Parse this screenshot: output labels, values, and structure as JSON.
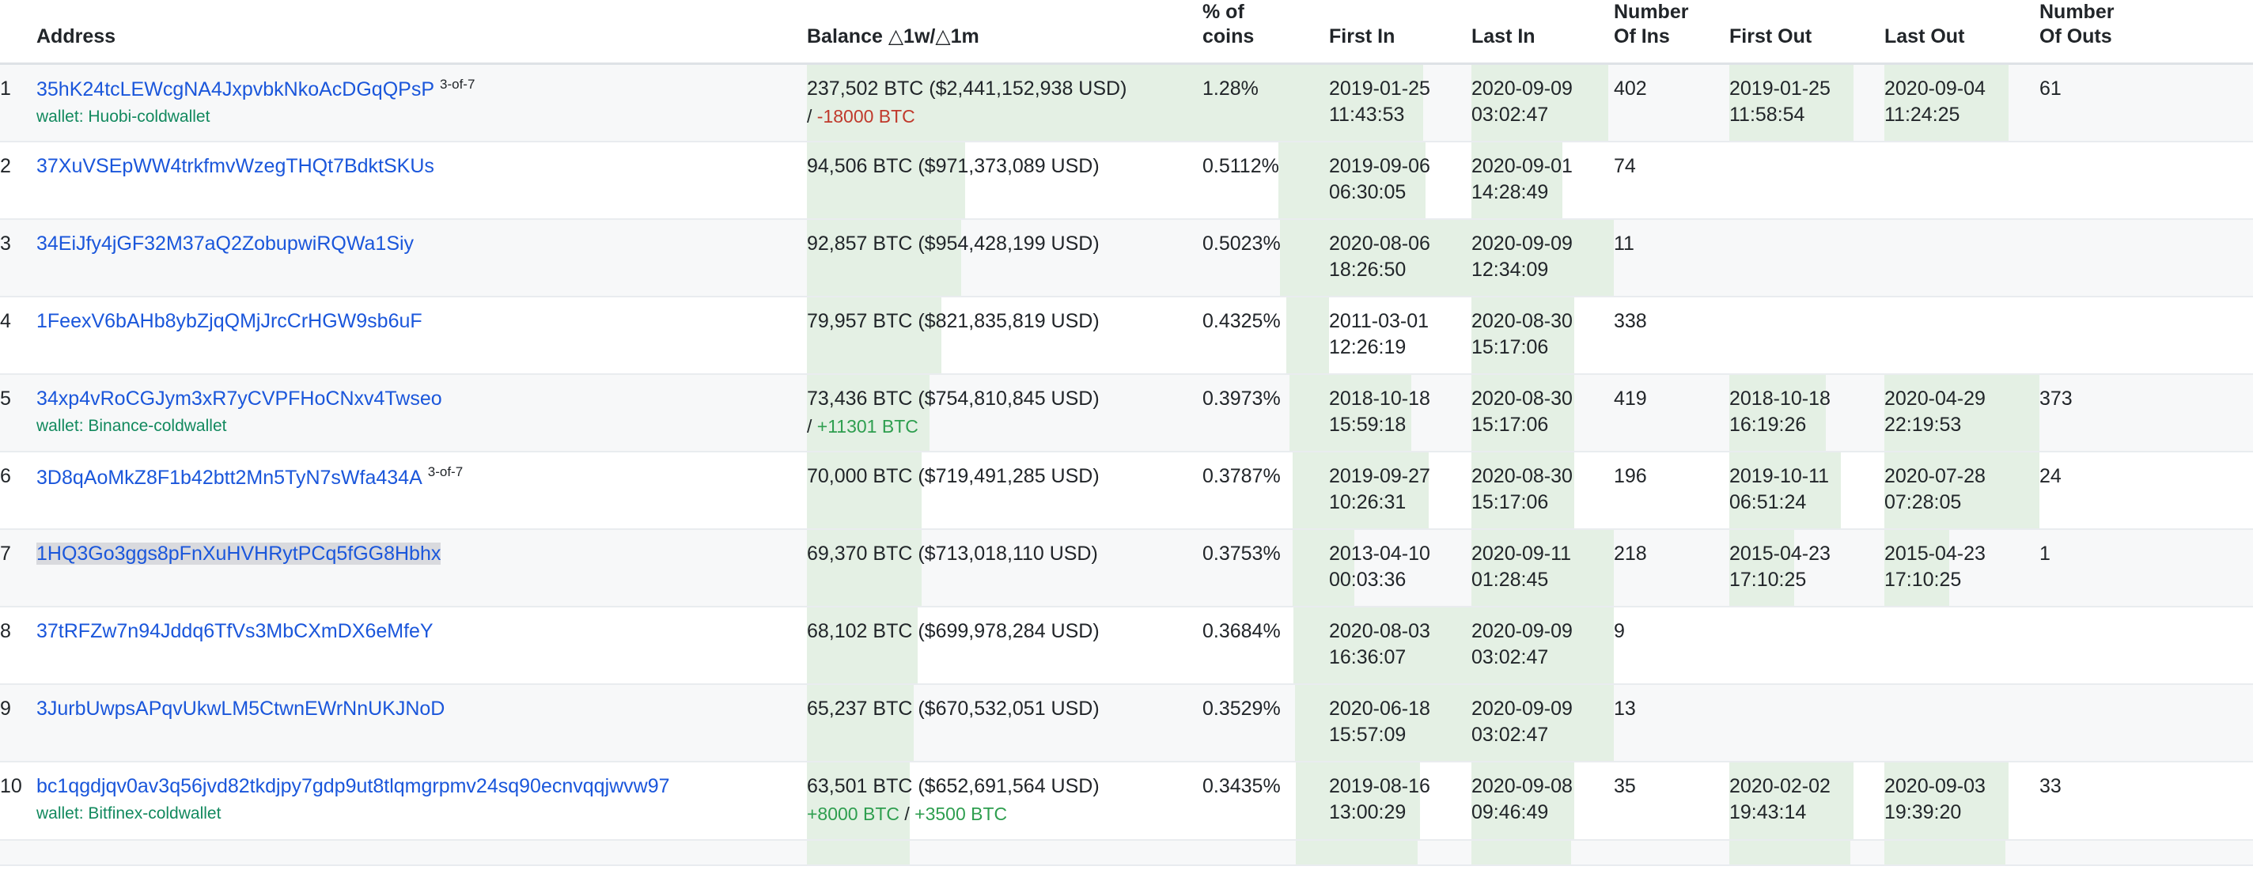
{
  "colors": {
    "link": "#1a56db",
    "wallet_tag": "#12895e",
    "delta_negative": "#c0392b",
    "delta_positive": "#2e9e4f",
    "bar_fill": "#e4f0e4",
    "row_alt": "#f7f8f9"
  },
  "table": {
    "headers": {
      "rank": "",
      "address": "Address",
      "balance": "Balance △1w/△1m",
      "percent": "% of\ncoins",
      "first_in": "First In",
      "last_in": "Last In",
      "number_of_ins": "Number\nOf Ins",
      "first_out": "First Out",
      "last_out": "Last Out",
      "number_of_outs": "Number\nOf Outs"
    },
    "rows": [
      {
        "rank": "1",
        "address": "35hK24tcLEWcgNA4JxpvbkNkoAcDGqQPsP",
        "multisig": "3-of-7",
        "wallet": "wallet: Huobi-coldwallet",
        "selected": false,
        "balance": "237,502 BTC ($2,441,152,938 USD)",
        "delta_prefix": "/ ",
        "delta_1w": "",
        "delta_1m": "-18000 BTC",
        "delta_1w_sign": "",
        "delta_1m_sign": "neg",
        "percent": "1.28%",
        "first_in_date": "2019-01-25",
        "first_in_time": "11:43:53",
        "last_in_date": "2020-09-09",
        "last_in_time": "03:02:47",
        "number_of_ins": "402",
        "first_out_date": "2019-01-25",
        "first_out_time": "11:58:54",
        "last_out_date": "2020-09-04",
        "last_out_time": "11:24:25",
        "number_of_outs": "61",
        "bar_balance": 100,
        "bar_percent": 100,
        "bar_first_in": 66,
        "bar_last_in": 96,
        "bar_number_of_ins": 0,
        "bar_first_out": 80,
        "bar_last_out": 80,
        "bar_number_of_outs": 0
      },
      {
        "rank": "2",
        "address": "37XuVSEpWW4trkfmvWzegTHQt7BdktSKUs",
        "multisig": "",
        "wallet": "",
        "selected": false,
        "balance": "94,506 BTC ($971,373,089 USD)",
        "delta_prefix": "",
        "delta_1w": "",
        "delta_1m": "",
        "delta_1w_sign": "",
        "delta_1m_sign": "",
        "percent": "0.5112%",
        "first_in_date": "2019-09-06",
        "first_in_time": "06:30:05",
        "last_in_date": "2020-09-01",
        "last_in_time": "14:28:49",
        "number_of_ins": "74",
        "first_out_date": "",
        "first_out_time": "",
        "last_out_date": "",
        "last_out_time": "",
        "number_of_outs": "",
        "bar_balance": 40,
        "bar_percent": 40,
        "bar_first_in": 68,
        "bar_last_in": 64,
        "bar_number_of_ins": 0,
        "bar_first_out": 0,
        "bar_last_out": 0,
        "bar_number_of_outs": 0
      },
      {
        "rank": "3",
        "address": "34EiJfy4jGF32M37aQ2ZobupwiRQWa1Siy",
        "multisig": "",
        "wallet": "",
        "selected": false,
        "balance": "92,857 BTC ($954,428,199 USD)",
        "delta_prefix": "",
        "delta_1w": "",
        "delta_1m": "",
        "delta_1w_sign": "",
        "delta_1m_sign": "",
        "percent": "0.5023%",
        "first_in_date": "2020-08-06",
        "first_in_time": "18:26:50",
        "last_in_date": "2020-09-09",
        "last_in_time": "12:34:09",
        "number_of_ins": "11",
        "first_out_date": "",
        "first_out_time": "",
        "last_out_date": "",
        "last_out_time": "",
        "number_of_outs": "",
        "bar_balance": 39,
        "bar_percent": 39,
        "bar_first_in": 100,
        "bar_last_in": 100,
        "bar_number_of_ins": 0,
        "bar_first_out": 0,
        "bar_last_out": 0,
        "bar_number_of_outs": 0
      },
      {
        "rank": "4",
        "address": "1FeexV6bAHb8ybZjqQMjJrcCrHGW9sb6uF",
        "multisig": "",
        "wallet": "",
        "selected": false,
        "balance": "79,957 BTC ($821,835,819 USD)",
        "delta_prefix": "",
        "delta_1w": "",
        "delta_1m": "",
        "delta_1w_sign": "",
        "delta_1m_sign": "",
        "percent": "0.4325%",
        "first_in_date": "2011-03-01",
        "first_in_time": "12:26:19",
        "last_in_date": "2020-08-30",
        "last_in_time": "15:17:06",
        "number_of_ins": "338",
        "first_out_date": "",
        "first_out_time": "",
        "last_out_date": "",
        "last_out_time": "",
        "number_of_outs": "",
        "bar_balance": 34,
        "bar_percent": 34,
        "bar_first_in": 0,
        "bar_last_in": 72,
        "bar_number_of_ins": 0,
        "bar_first_out": 0,
        "bar_last_out": 0,
        "bar_number_of_outs": 0
      },
      {
        "rank": "5",
        "address": "34xp4vRoCGJym3xR7yCVPFHoCNxv4Twseo",
        "multisig": "",
        "wallet": "wallet: Binance-coldwallet",
        "selected": false,
        "balance": "73,436 BTC ($754,810,845 USD)",
        "delta_prefix": "/ ",
        "delta_1w": "",
        "delta_1m": "+11301 BTC",
        "delta_1w_sign": "",
        "delta_1m_sign": "pos",
        "percent": "0.3973%",
        "first_in_date": "2018-10-18",
        "first_in_time": "15:59:18",
        "last_in_date": "2020-08-30",
        "last_in_time": "15:17:06",
        "number_of_ins": "419",
        "first_out_date": "2018-10-18",
        "first_out_time": "16:19:26",
        "last_out_date": "2020-04-29",
        "last_out_time": "22:19:53",
        "number_of_outs": "373",
        "bar_balance": 31,
        "bar_percent": 31,
        "bar_first_in": 58,
        "bar_last_in": 72,
        "bar_number_of_ins": 0,
        "bar_first_out": 62,
        "bar_last_out": 100,
        "bar_number_of_outs": 0
      },
      {
        "rank": "6",
        "address": "3D8qAoMkZ8F1b42btt2Mn5TyN7sWfa434A",
        "multisig": "3-of-7",
        "wallet": "",
        "selected": false,
        "balance": "70,000 BTC ($719,491,285 USD)",
        "delta_prefix": "",
        "delta_1w": "",
        "delta_1m": "",
        "delta_1w_sign": "",
        "delta_1m_sign": "",
        "percent": "0.3787%",
        "first_in_date": "2019-09-27",
        "first_in_time": "10:26:31",
        "last_in_date": "2020-08-30",
        "last_in_time": "15:17:06",
        "number_of_ins": "196",
        "first_out_date": "2019-10-11",
        "first_out_time": "06:51:24",
        "last_out_date": "2020-07-28",
        "last_out_time": "07:28:05",
        "number_of_outs": "24",
        "bar_balance": 29,
        "bar_percent": 29,
        "bar_first_in": 70,
        "bar_last_in": 72,
        "bar_number_of_ins": 0,
        "bar_first_out": 72,
        "bar_last_out": 100,
        "bar_number_of_outs": 0
      },
      {
        "rank": "7",
        "address": "1HQ3Go3ggs8pFnXuHVHRytPCq5fGG8Hbhx",
        "multisig": "",
        "wallet": "",
        "selected": true,
        "balance": "69,370 BTC ($713,018,110 USD)",
        "delta_prefix": "",
        "delta_1w": "",
        "delta_1m": "",
        "delta_1w_sign": "",
        "delta_1m_sign": "",
        "percent": "0.3753%",
        "first_in_date": "2013-04-10",
        "first_in_time": "00:03:36",
        "last_in_date": "2020-09-11",
        "last_in_time": "01:28:45",
        "number_of_ins": "218",
        "first_out_date": "2015-04-23",
        "first_out_time": "17:10:25",
        "last_out_date": "2015-04-23",
        "last_out_time": "17:10:25",
        "number_of_outs": "1",
        "bar_balance": 29,
        "bar_percent": 29,
        "bar_first_in": 18,
        "bar_last_in": 100,
        "bar_number_of_ins": 0,
        "bar_first_out": 42,
        "bar_last_out": 42,
        "bar_number_of_outs": 0
      },
      {
        "rank": "8",
        "address": "37tRFZw7n94Jddq6TfVs3MbCXmDX6eMfeY",
        "multisig": "",
        "wallet": "",
        "selected": false,
        "balance": "68,102 BTC ($699,978,284 USD)",
        "delta_prefix": "",
        "delta_1w": "",
        "delta_1m": "",
        "delta_1w_sign": "",
        "delta_1m_sign": "",
        "percent": "0.3684%",
        "first_in_date": "2020-08-03",
        "first_in_time": "16:36:07",
        "last_in_date": "2020-09-09",
        "last_in_time": "03:02:47",
        "number_of_ins": "9",
        "first_out_date": "",
        "first_out_time": "",
        "last_out_date": "",
        "last_out_time": "",
        "number_of_outs": "",
        "bar_balance": 28,
        "bar_percent": 28,
        "bar_first_in": 100,
        "bar_last_in": 100,
        "bar_number_of_ins": 0,
        "bar_first_out": 0,
        "bar_last_out": 0,
        "bar_number_of_outs": 0
      },
      {
        "rank": "9",
        "address": "3JurbUwpsAPqvUkwLM5CtwnEWrNnUKJNoD",
        "multisig": "",
        "wallet": "",
        "selected": false,
        "balance": "65,237 BTC ($670,532,051 USD)",
        "delta_prefix": "",
        "delta_1w": "",
        "delta_1m": "",
        "delta_1w_sign": "",
        "delta_1m_sign": "",
        "percent": "0.3529%",
        "first_in_date": "2020-06-18",
        "first_in_time": "15:57:09",
        "last_in_date": "2020-09-09",
        "last_in_time": "03:02:47",
        "number_of_ins": "13",
        "first_out_date": "",
        "first_out_time": "",
        "last_out_date": "",
        "last_out_time": "",
        "number_of_outs": "",
        "bar_balance": 27,
        "bar_percent": 27,
        "bar_first_in": 100,
        "bar_last_in": 100,
        "bar_number_of_ins": 0,
        "bar_first_out": 0,
        "bar_last_out": 0,
        "bar_number_of_outs": 0
      },
      {
        "rank": "10",
        "address": "bc1qgdjqv0av3q56jvd82tkdjpy7gdp9ut8tlqmgrpmv24sq90ecnvqqjwvw97",
        "multisig": "",
        "wallet": "wallet: Bitfinex-coldwallet",
        "selected": false,
        "balance": "63,501 BTC ($652,691,564 USD)",
        "delta_prefix": "",
        "delta_1w": "+8000 BTC",
        "delta_1m": "+3500 BTC",
        "delta_1w_sign": "pos",
        "delta_1m_sign": "pos",
        "percent": "0.3435%",
        "first_in_date": "2019-08-16",
        "first_in_time": "13:00:29",
        "last_in_date": "2020-09-08",
        "last_in_time": "09:46:49",
        "number_of_ins": "35",
        "first_out_date": "2020-02-02",
        "first_out_time": "19:43:14",
        "last_out_date": "2020-09-03",
        "last_out_time": "19:39:20",
        "number_of_outs": "33",
        "bar_balance": 26,
        "bar_percent": 26,
        "bar_first_in": 64,
        "bar_last_in": 72,
        "bar_number_of_ins": 0,
        "bar_first_out": 80,
        "bar_last_out": 80,
        "bar_number_of_outs": 0
      },
      {
        "rank": "",
        "address": "",
        "multisig": "",
        "wallet": "",
        "selected": false,
        "balance": "",
        "delta_prefix": "",
        "delta_1w": "",
        "delta_1m": "",
        "delta_1w_sign": "",
        "delta_1m_sign": "",
        "percent": "",
        "first_in_date": "",
        "first_in_time": "",
        "last_in_date": "",
        "last_in_time": "",
        "number_of_ins": "",
        "first_out_date": "",
        "first_out_time": "",
        "last_out_date": "",
        "last_out_time": "",
        "number_of_outs": "",
        "bar_balance": 26,
        "bar_percent": 26,
        "bar_first_in": 62,
        "bar_last_in": 70,
        "bar_number_of_ins": 0,
        "bar_first_out": 78,
        "bar_last_out": 78,
        "bar_number_of_outs": 0
      }
    ]
  }
}
